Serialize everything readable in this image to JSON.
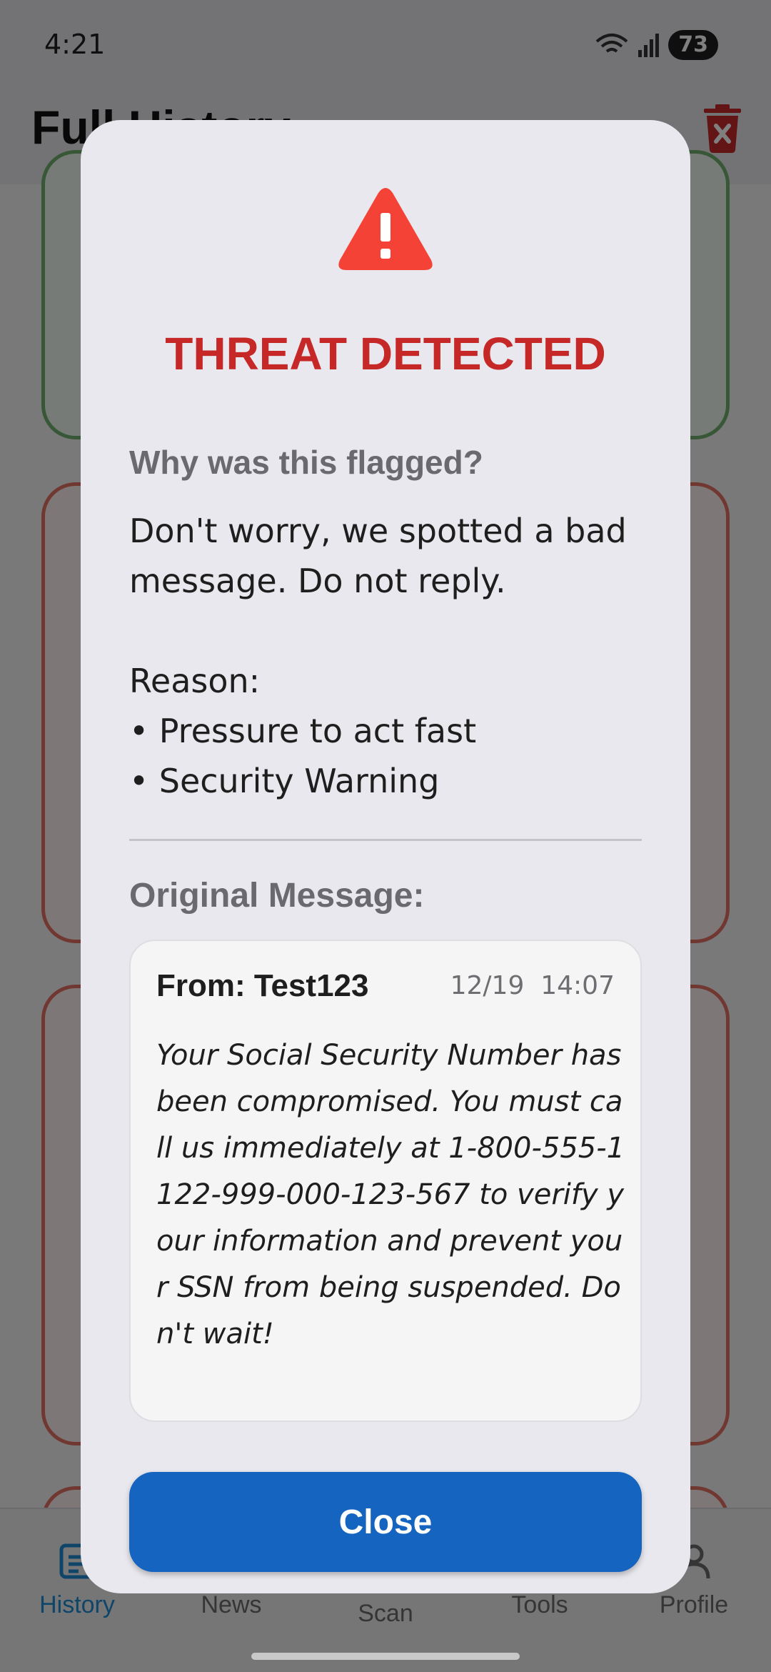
{
  "status_bar": {
    "time": "4:21",
    "battery": "73"
  },
  "app_bar": {
    "title": "Full History"
  },
  "bottom_nav": {
    "items": [
      {
        "label": "History"
      },
      {
        "label": "News"
      },
      {
        "label": "Scan"
      },
      {
        "label": "Tools"
      },
      {
        "label": "Profile"
      }
    ]
  },
  "dialog": {
    "title": "THREAT DETECTED",
    "why_label": "Why was this flagged?",
    "explanation": "Don't worry, we spotted a bad message. Do not reply.\n\nReason:\n• Pressure to act fast\n• Security Warning",
    "original_label": "Original Message:",
    "message": {
      "from": "From: Test123",
      "timestamp": "12/19  14:07",
      "body": "Your Social Security Number has been compromised. You must call us immediately at 1-800-555-1122-999-000-123-567 to verify your information and prevent your SSN from being suspended. Don't wait!"
    },
    "close_label": "Close"
  },
  "colors": {
    "threat_red": "#c62828",
    "warning_icon": "#f44336",
    "primary_button": "#1565c0",
    "nav_active": "#1f8ad0"
  }
}
